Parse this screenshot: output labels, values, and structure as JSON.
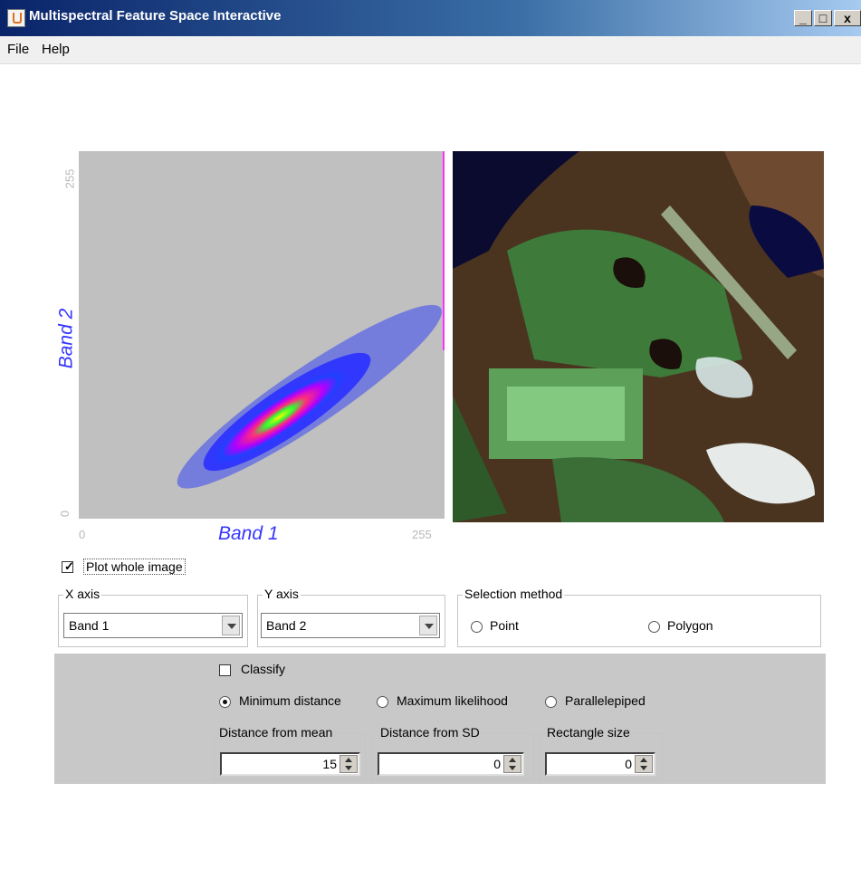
{
  "window": {
    "title": "Multispectral Feature Space Interactive"
  },
  "menu": {
    "file": "File",
    "help": "Help"
  },
  "plot": {
    "x_axis_label": "Band 1",
    "y_axis_label": "Band 2",
    "x_min_tick": "0",
    "x_max_tick": "255",
    "y_min_tick": "0",
    "y_max_tick": "255",
    "background_color": "#c0c0c0",
    "label_color": "#3636ff"
  },
  "controls": {
    "plot_whole_image": {
      "label": "Plot whole image",
      "checked": true
    },
    "x_axis": {
      "group_label": "X axis",
      "selected": "Band 1"
    },
    "y_axis": {
      "group_label": "Y axis",
      "selected": "Band 2"
    },
    "selection_method": {
      "group_label": "Selection method",
      "options": [
        "Point",
        "Polygon"
      ],
      "selected": null
    },
    "classify": {
      "label": "Classify",
      "checked": false
    },
    "classifier": {
      "options": [
        "Minimum distance",
        "Maximum likelihood",
        "Parallelepiped"
      ],
      "selected": "Minimum distance"
    },
    "distance_from_mean": {
      "label": "Distance from mean",
      "value": "15"
    },
    "distance_from_sd": {
      "label": "Distance from SD",
      "value": "0"
    },
    "rectangle_size": {
      "label": "Rectangle size",
      "value": "0"
    }
  }
}
